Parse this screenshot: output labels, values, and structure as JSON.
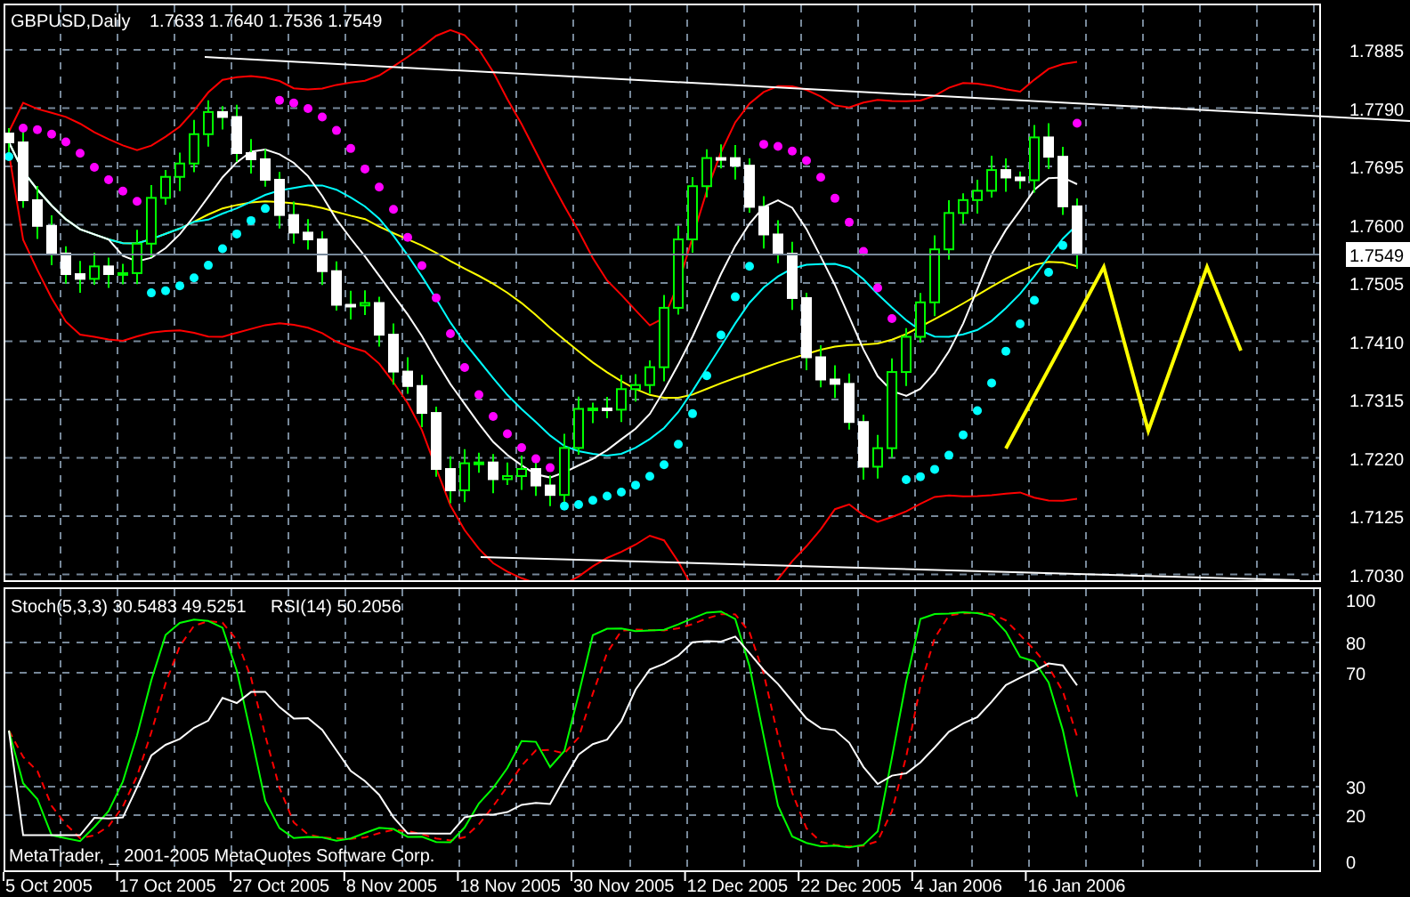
{
  "chart": {
    "symbol": "GBPUSD,Daily",
    "quote": "1.7633 1.7640 1.7536 1.7549",
    "price_axis": [
      "1.7885",
      "1.7790",
      "1.7695",
      "1.7600",
      "1.7505",
      "1.7410",
      "1.7315",
      "1.7220",
      "1.7125",
      "1.7030"
    ],
    "current_price": "1.7549"
  },
  "indicator_panel": {
    "stochastic_label": "Stoch(5,3,3) 30.5483 49.5251",
    "rsi_label": "RSI(14) 50.2056",
    "scale": [
      "100",
      "80",
      "70",
      "30",
      "20",
      "0"
    ],
    "copyright": "MetaTrader, _ 2001-2005 MetaQuotes Software Corp."
  },
  "date_axis": [
    "5 Oct 2005",
    "17 Oct 2005",
    "27 Oct 2005",
    "8 Nov 2005",
    "18 Nov 2005",
    "30 Nov 2005",
    "12 Dec 2005",
    "22 Dec 2005",
    "4 Jan 2006",
    "16 Jan 2006"
  ]
}
